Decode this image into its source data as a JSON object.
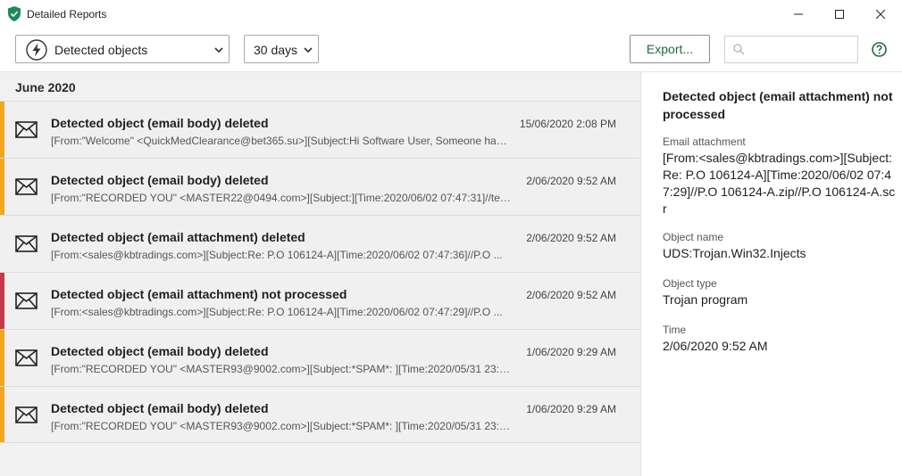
{
  "window": {
    "title": "Detailed Reports"
  },
  "toolbar": {
    "type_select": "Detected objects",
    "period_select": "30 days",
    "export_label": "Export...",
    "search_placeholder": "",
    "accent": "#1e6b3b"
  },
  "list": {
    "month": "June 2020",
    "items": [
      {
        "title": "Detected object (email body) deleted",
        "date": "15/06/2020 2:08 PM",
        "desc": "[From:\"Welcome\" <QuickMedClearance@bet365.su>][Subject:Hi Software User, Someone have...",
        "status_color": "#f0a81c"
      },
      {
        "title": "Detected object (email body) deleted",
        "date": "2/06/2020 9:52 AM",
        "desc": "[From:\"RECORDED YOU\" <MASTER22@0494.com>][Subject:][Time:2020/06/02 07:47:31]//text/p...",
        "status_color": "#f0a81c"
      },
      {
        "title": "Detected object (email attachment) deleted",
        "date": "2/06/2020 9:52 AM",
        "desc": "[From:<sales@kbtradings.com>][Subject:Re: P.O 106124-A][Time:2020/06/02 07:47:36]//P.O ...",
        "status_color": "#f0f0f0"
      },
      {
        "title": "Detected object (email attachment) not processed",
        "date": "2/06/2020 9:52 AM",
        "desc": "[From:<sales@kbtradings.com>][Subject:Re: P.O 106124-A][Time:2020/06/02 07:47:29]//P.O ...",
        "status_color": "#c23a4b"
      },
      {
        "title": "Detected object (email body) deleted",
        "date": "1/06/2020 9:29 AM",
        "desc": "[From:\"RECORDED YOU\" <MASTER93@9002.com>][Subject:*SPAM*: ][Time:2020/05/31 23:38:2...",
        "status_color": "#f0a81c"
      },
      {
        "title": "Detected object (email body) deleted",
        "date": "1/06/2020 9:29 AM",
        "desc": "[From:\"RECORDED YOU\" <MASTER93@9002.com>][Subject:*SPAM*: ][Time:2020/05/31 23:38:2...",
        "status_color": "#f0a81c"
      }
    ]
  },
  "details": {
    "title": "Detected object (email attachment) not processed",
    "attachment_label": "Email attachment",
    "attachment_value": "[From:<sales@kbtradings.com>][Subject:Re: P.O 106124-A][Time:2020/06/02 07:47:29]//P.O 106124-A.zip//P.O 106124-A.scr",
    "object_name_label": "Object name",
    "object_name_value": "UDS:Trojan.Win32.Injects",
    "object_type_label": "Object type",
    "object_type_value": "Trojan program",
    "time_label": "Time",
    "time_value": "2/06/2020 9:52 AM"
  }
}
